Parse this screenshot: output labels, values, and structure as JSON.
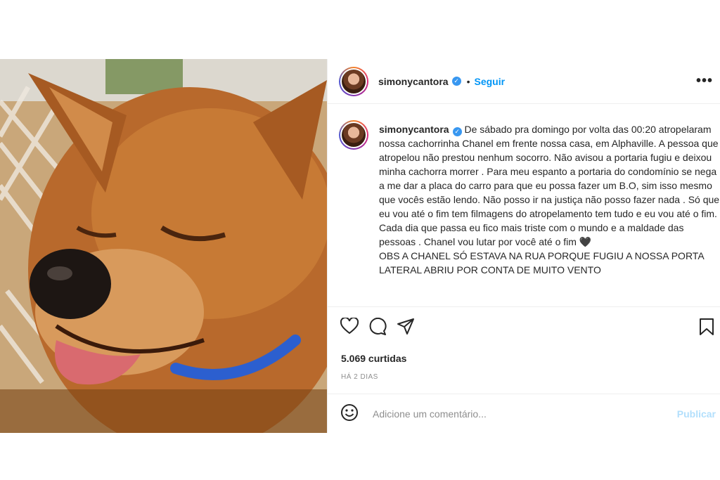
{
  "post": {
    "username": "simonycantora",
    "follow_label": "Seguir",
    "separator": "•",
    "more_label": "•••",
    "caption": "De sábado pra domingo por volta das 00:20 atropelaram nossa cachorrinha Chanel em frente nossa casa, em Alphaville. A pessoa que atropelou não prestou nenhum socorro. Não avisou a portaria fugiu e deixou minha cachorra morrer . Para meu espanto a portaria do condomínio se nega a me dar a placa do carro para que eu possa fazer um B.O, sim isso mesmo que vocês estão lendo. Não posso ir na justiça não posso fazer nada . Só que eu vou até o fim tem filmagens do atropelamento tem tudo e eu vou até o fim. Cada dia que passa eu fico mais triste com o mundo e a maldade das pessoas . Chanel vou lutar por você até o fim 🖤\nOBS A CHANEL SÓ ESTAVA NA RUA PORQUE FUGIU A NOSSA PORTA LATERAL ABRIU POR CONTA DE MUITO VENTO",
    "likes": "5.069 curtidas",
    "date": "HÁ 2 DIAS",
    "comment_placeholder": "Adicione um comentário...",
    "publish_label": "Publicar"
  },
  "colors": {
    "accent": "#0095f6",
    "verified": "#3897f0",
    "publish_disabled": "#b2dffc"
  },
  "icons": [
    "heart-icon",
    "comment-icon",
    "share-icon",
    "bookmark-icon",
    "emoji-icon",
    "verified-badge-icon"
  ]
}
